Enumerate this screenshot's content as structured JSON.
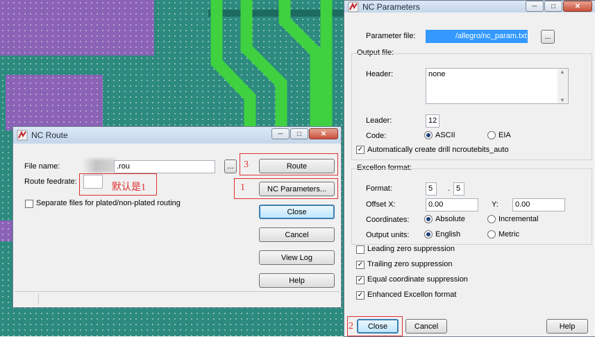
{
  "nc_route": {
    "title": "NC Route",
    "file_name_label": "File name:",
    "file_name_value": ".rou",
    "browse_label": "...",
    "route_feedrate_label": "Route feedrate:",
    "route_feedrate_value": "",
    "separate_files_label": "Separate files for plated/non-plated routing",
    "separate_files_checked": false,
    "buttons": {
      "route": "Route",
      "nc_parameters": "NC Parameters...",
      "close": "Close",
      "cancel": "Cancel",
      "view_log": "View Log",
      "help": "Help"
    },
    "annotations": {
      "num_3": "3",
      "num_1": "1",
      "default_note": "默认是1"
    }
  },
  "nc_params": {
    "title": "NC Parameters",
    "parameter_file_label": "Parameter file:",
    "parameter_file_value": "/allegro/nc_param.txt",
    "browse_label": "...",
    "output_file_label": "Output file:",
    "header_label": "Header:",
    "header_value": "none",
    "leader_label": "Leader:",
    "leader_value": "12",
    "code_label": "Code:",
    "code_ascii": "ASCII",
    "code_eia": "EIA",
    "auto_create_label": "Automatically create drill ncroutebits_auto",
    "excellon_label": "Excellon format:",
    "format_label": "Format:",
    "format_int": "5",
    "format_sep": ".",
    "format_dec": "5",
    "offset_x_label": "Offset X:",
    "offset_x_value": "0.00",
    "y_label": "Y:",
    "offset_y_value": "0.00",
    "coordinates_label": "Coordinates:",
    "coord_absolute": "Absolute",
    "coord_incremental": "Incremental",
    "output_units_label": "Output units:",
    "units_english": "English",
    "units_metric": "Metric",
    "checks": {
      "leading_zero": "Leading zero suppression",
      "trailing_zero": "Trailing zero suppression",
      "equal_coord": "Equal coordinate suppression",
      "enhanced_excellon": "Enhanced Excellon format"
    },
    "buttons": {
      "close": "Close",
      "cancel": "Cancel",
      "help": "Help"
    },
    "annotations": {
      "num_2": "2"
    }
  },
  "colors": {
    "accent_red": "#e03030",
    "pcb_bg": "#2c8a7e",
    "trace": "#3fd13f",
    "purple": "#8a62b6"
  }
}
